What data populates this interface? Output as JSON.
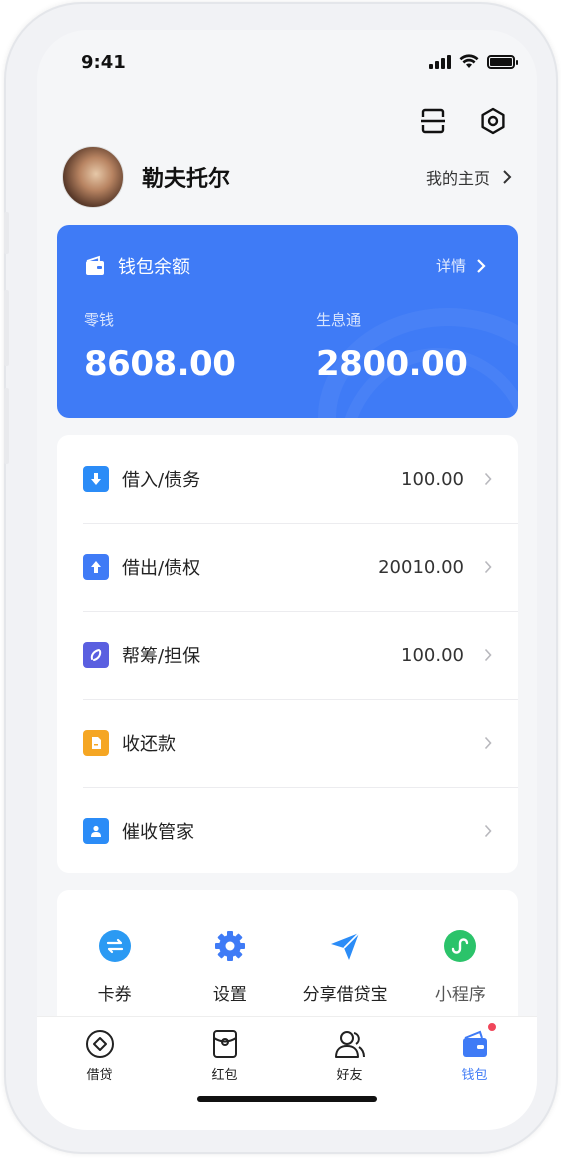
{
  "status_bar": {
    "time": "9:41"
  },
  "profile": {
    "name": "勒夫托尔",
    "home_link": "我的主页"
  },
  "balance_card": {
    "title": "钱包余额",
    "detail_label": "详情",
    "change_label": "零钱",
    "change_value": "8608.00",
    "interest_label": "生息通",
    "interest_value": "2800.00",
    "accent_color": "#3f7bf6"
  },
  "list_items": [
    {
      "label": "借入/债务",
      "value": "100.00",
      "icon": "download-icon",
      "color": "#2b8cf7"
    },
    {
      "label": "借出/债权",
      "value": "20010.00",
      "icon": "upload-icon",
      "color": "#3f7bf6"
    },
    {
      "label": "帮筹/担保",
      "value": "100.00",
      "icon": "swirl-icon",
      "color": "#5a5fe0"
    },
    {
      "label": "收还款",
      "value": "",
      "icon": "document-icon",
      "color": "#f5a623"
    },
    {
      "label": "催收管家",
      "value": "",
      "icon": "person-badge-icon",
      "color": "#2b8cf7"
    }
  ],
  "shortcuts": [
    {
      "label": "卡券",
      "icon": "exchange-icon",
      "color": "#2b9af3"
    },
    {
      "label": "设置",
      "icon": "gear-icon",
      "color": "#3f7bf6"
    },
    {
      "label": "分享借贷宝",
      "icon": "send-icon",
      "color": "#2b8cf7"
    },
    {
      "label": "小程序",
      "icon": "mini-program-icon",
      "color": "#2bc36a"
    }
  ],
  "tabs": [
    {
      "label": "借贷",
      "icon": "loan-icon"
    },
    {
      "label": "红包",
      "icon": "red-packet-icon"
    },
    {
      "label": "好友",
      "icon": "friends-icon"
    },
    {
      "label": "钱包",
      "icon": "wallet-icon",
      "active": true,
      "badge": true
    }
  ]
}
